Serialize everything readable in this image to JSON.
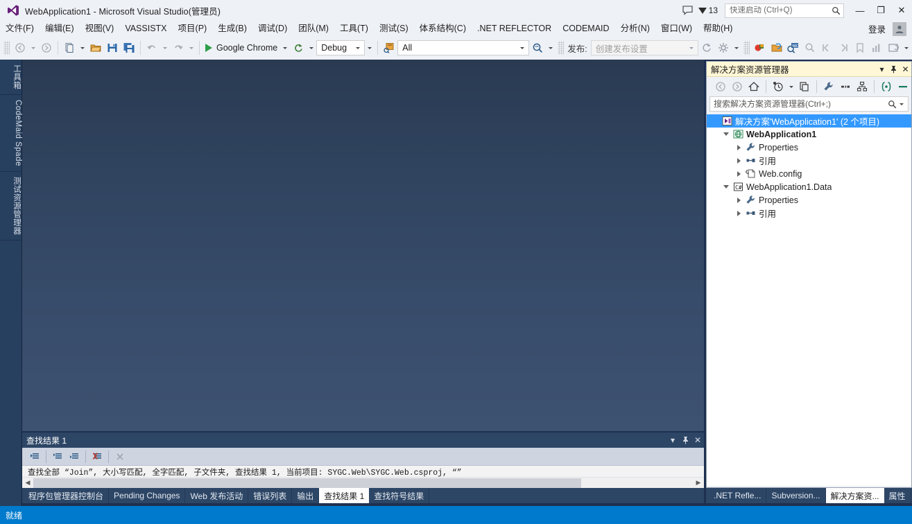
{
  "window": {
    "title": "WebApplication1 - Microsoft Visual Studio(管理员)",
    "logo_icon": "visual-studio-logo-icon",
    "minimize_label": "—",
    "maximize_label": "❐",
    "close_label": "✕"
  },
  "titlebar": {
    "feedback_icon": "feedback-bubble-icon",
    "notification_count": "13",
    "notification_icon": "notification-flag-icon",
    "quick_launch_placeholder": "快速启动 (Ctrl+Q)",
    "quick_launch_value": "",
    "search_icon": "search-magnifier-icon"
  },
  "menubar": {
    "items": [
      {
        "label": "文件(F)",
        "accel": "F"
      },
      {
        "label": "编辑(E)",
        "accel": "E"
      },
      {
        "label": "视图(V)",
        "accel": "V"
      },
      {
        "label": "VASSISTX",
        "accel": "X"
      },
      {
        "label": "项目(P)",
        "accel": "P"
      },
      {
        "label": "生成(B)",
        "accel": "B"
      },
      {
        "label": "调试(D)",
        "accel": "D"
      },
      {
        "label": "团队(M)",
        "accel": "M"
      },
      {
        "label": "工具(T)",
        "accel": "T"
      },
      {
        "label": "测试(S)",
        "accel": "S"
      },
      {
        "label": "体系结构(C)",
        "accel": "C"
      },
      {
        "label": ".NET REFLECTOR",
        "accel": ""
      },
      {
        "label": "CODEMAID",
        "accel": "C"
      },
      {
        "label": "分析(N)",
        "accel": "N"
      },
      {
        "label": "窗口(W)",
        "accel": "W"
      },
      {
        "label": "帮助(H)",
        "accel": "H"
      }
    ],
    "signin_label": "登录",
    "account_icon": "user-account-icon"
  },
  "toolbar": {
    "nav_back_icon": "navigate-back-icon",
    "nav_forward_icon": "navigate-forward-icon",
    "new_project_icon": "new-project-icon",
    "open_file_icon": "open-file-icon",
    "save_icon": "save-icon",
    "save_all_icon": "save-all-icon",
    "undo_icon": "undo-icon",
    "redo_icon": "redo-icon",
    "start_label": "Google Chrome",
    "start_icon": "start-debug-play-icon",
    "refresh_icon": "refresh-browser-icon",
    "config_value": "Debug",
    "platform_icon": "find-in-files-icon",
    "filter_value": "All",
    "find_icon": "quick-find-icon",
    "publish_label": "发布:",
    "publish_placeholder": "创建发布设置",
    "publish_value": "",
    "sync_icon": "sync-icon",
    "settings_icon": "gear-settings-icon",
    "breakpoint_icon": "breakpoint-icon",
    "reflector_icon": "reflector-icon",
    "object_browser_icon": "object-browser-icon",
    "zoom_icon": "zoom-icon",
    "step_back_icon": "step-back-icon",
    "step_forward_icon": "step-forward-icon",
    "bookmark_icon": "bookmark-icon",
    "chart_icon": "chart-icon",
    "window_icon": "window-icon"
  },
  "left_rail": {
    "tabs": [
      {
        "label": "工具箱"
      },
      {
        "label": "CodeMaid Spade"
      },
      {
        "label": "测试资源管理器"
      }
    ]
  },
  "solution_explorer": {
    "title": "解决方案资源管理器",
    "dropdown_icon": "chevron-down-icon",
    "pin_icon": "pin-icon",
    "close_icon": "close-icon",
    "toolbar": {
      "back_icon": "back-icon",
      "forward_icon": "forward-icon",
      "home_icon": "home-icon",
      "pending_changes_icon": "pending-changes-icon",
      "pending_caret_icon": "chevron-down-icon",
      "sync_views_icon": "sync-with-active-document-icon",
      "properties_icon": "properties-wrench-icon",
      "show_all_files_icon": "show-all-files-icon",
      "class_view_icon": "class-view-icon",
      "preview_icon": "preview-selected-items-icon",
      "collapse_icon": "collapse-all-icon"
    },
    "search_placeholder": "搜索解决方案资源管理器(Ctrl+;)",
    "search_value": "",
    "search_icon": "search-magnifier-icon",
    "search_caret_icon": "chevron-down-icon",
    "tree": [
      {
        "label": "解决方案'WebApplication1' (2 个项目)",
        "icon": "solution-icon",
        "indent": 0,
        "expander": "none",
        "selected": true,
        "bold": false
      },
      {
        "label": "WebApplication1",
        "icon": "web-project-icon",
        "indent": 1,
        "expander": "down",
        "selected": false,
        "bold": true
      },
      {
        "label": "Properties",
        "icon": "properties-wrench-icon",
        "indent": 2,
        "expander": "right",
        "selected": false,
        "bold": false
      },
      {
        "label": "引用",
        "icon": "references-icon",
        "indent": 2,
        "expander": "right",
        "selected": false,
        "bold": false
      },
      {
        "label": "Web.config",
        "icon": "config-file-icon",
        "indent": 2,
        "expander": "right",
        "selected": false,
        "bold": false
      },
      {
        "label": "WebApplication1.Data",
        "icon": "csharp-project-icon",
        "indent": 1,
        "expander": "down",
        "selected": false,
        "bold": false
      },
      {
        "label": "Properties",
        "icon": "properties-wrench-icon",
        "indent": 2,
        "expander": "right",
        "selected": false,
        "bold": false
      },
      {
        "label": "引用",
        "icon": "references-icon",
        "indent": 2,
        "expander": "right",
        "selected": false,
        "bold": false
      }
    ]
  },
  "find_results": {
    "title": "查找结果 1",
    "dropdown_icon": "chevron-down-icon",
    "pin_icon": "pin-icon",
    "close_icon": "close-icon",
    "toolbar": {
      "goto_icon": "go-to-location-icon",
      "prev_icon": "previous-location-icon",
      "next_icon": "next-location-icon",
      "clear_icon": "clear-all-icon",
      "cancel_icon": "cancel-icon"
    },
    "line": "查找全部 “Join”, 大小写匹配, 全字匹配, 子文件夹, 查找结果 1, 当前项目: SYGC.Web\\SYGC.Web.csproj, “”",
    "scroll_left_icon": "scroll-left-icon",
    "scroll_right_icon": "scroll-right-icon"
  },
  "bottom_tabs": {
    "left": [
      {
        "label": "程序包管理器控制台",
        "active": false
      },
      {
        "label": "Pending Changes",
        "active": false
      },
      {
        "label": "Web 发布活动",
        "active": false
      },
      {
        "label": "错误列表",
        "active": false
      },
      {
        "label": "输出",
        "active": false
      },
      {
        "label": "查找结果 1",
        "active": true
      },
      {
        "label": "查找符号结果",
        "active": false
      }
    ],
    "right": [
      {
        "label": ".NET Refle...",
        "active": false
      },
      {
        "label": "Subversion...",
        "active": false
      },
      {
        "label": "解决方案资...",
        "active": true
      },
      {
        "label": "属性",
        "active": false
      }
    ]
  },
  "statusbar": {
    "text": "就绪",
    "accent_color": "#007acc"
  },
  "colors": {
    "title_bg": "#eef1f6",
    "editor_gradient_top": "#2a3a52",
    "editor_gradient_bottom": "#3d5270",
    "panel_header": "#2d4666",
    "selection_blue": "#3399ff",
    "se_title_bg": "#fff7d6",
    "status_blue": "#007acc",
    "play_green": "#2e9e48"
  }
}
